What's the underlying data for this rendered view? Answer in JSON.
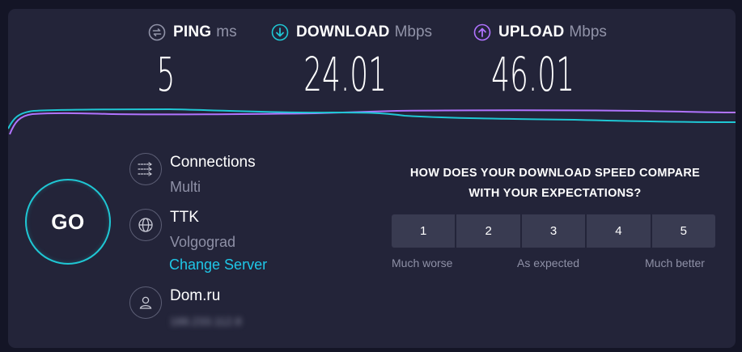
{
  "metrics": {
    "ping": {
      "name": "PING",
      "unit": "ms",
      "value": "5",
      "icon": "ping-icon",
      "color": "#9193a8"
    },
    "download": {
      "name": "DOWNLOAD",
      "unit": "Mbps",
      "value": "24.01",
      "icon": "download-arrow-icon",
      "color": "#1fc7d4"
    },
    "upload": {
      "name": "UPLOAD",
      "unit": "Mbps",
      "value": "46.01",
      "icon": "upload-arrow-icon",
      "color": "#b073ff"
    }
  },
  "go_button": {
    "label": "GO",
    "color": "#1fc7d4"
  },
  "connections": {
    "title": "Connections",
    "value": "Multi",
    "icon": "connections-icon"
  },
  "server": {
    "name": "TTK",
    "location": "Volgograd",
    "change_label": "Change Server",
    "icon": "globe-icon",
    "link_color": "#1fc7e8"
  },
  "provider": {
    "name": "Dom.ru",
    "ip": "188.233.112.8",
    "icon": "user-icon"
  },
  "survey": {
    "question_line1": "HOW DOES YOUR DOWNLOAD SPEED COMPARE",
    "question_line2": "WITH YOUR EXPECTATIONS?",
    "ratings": [
      "1",
      "2",
      "3",
      "4",
      "5"
    ],
    "label_low": "Much worse",
    "label_mid": "As expected",
    "label_high": "Much better"
  },
  "colors": {
    "background": "#141526",
    "panel": "#232439",
    "download": "#1fc7d4",
    "upload": "#b073ff"
  }
}
